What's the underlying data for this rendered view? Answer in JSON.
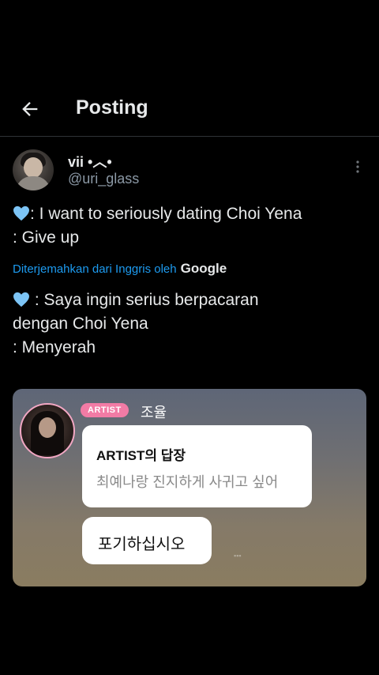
{
  "header": {
    "title": "Posting",
    "back_icon": "arrow-left-icon"
  },
  "tweet": {
    "user": {
      "name": "vii •︿•",
      "handle": "@uri_glass"
    },
    "more_icon": "more-vertical-icon",
    "heart_icon": "blue-heart-icon",
    "heart_color": "#7cc4f5",
    "original_text": ": I want to seriously dating Choi Yena\n: Give up",
    "translation": {
      "label": "Diterjemahkan dari Inggris oleh",
      "provider": "Google"
    },
    "translated_text": " : Saya ingin serius berpacaran\ndengan Choi Yena\n: Menyerah"
  },
  "media": {
    "artist_badge": "ARTIST",
    "artist_name": "조율",
    "reply_title": "ARTIST의 답장",
    "reply_quote": "최예나랑 진지하게 사귀고 싶어",
    "answer": "포기하십시오",
    "badge_color": "#f27ba5"
  },
  "colors": {
    "background": "#000000",
    "text": "#e7e9ea",
    "secondary": "#8b98a5",
    "link": "#1d9bf0"
  }
}
